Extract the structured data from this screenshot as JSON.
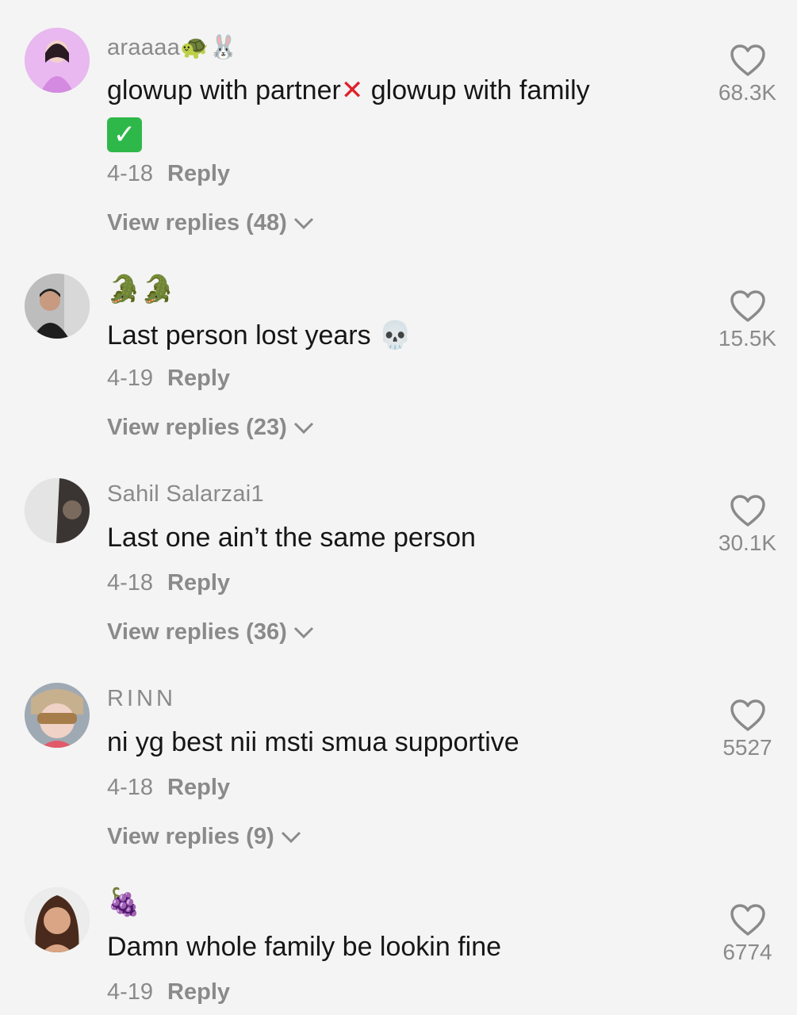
{
  "comments": [
    {
      "author": "araaaa",
      "author_emoji": "🐢🐰",
      "text_part1": "glowup with partner",
      "text_mark1": "✕",
      "text_part2": " glowup with family",
      "text_mark2": "✓",
      "date": "4-18",
      "reply_label": "Reply",
      "view_replies": "View replies (48)",
      "likes": "68.3K"
    },
    {
      "author": "",
      "author_emoji": "🐊🐊",
      "text": "Last person lost years 💀",
      "date": "4-19",
      "reply_label": "Reply",
      "view_replies": "View replies (23)",
      "likes": "15.5K"
    },
    {
      "author": "Sahil Salarzai1",
      "text": "Last one ain’t the same person",
      "date": "4-18",
      "reply_label": "Reply",
      "view_replies": "View replies (36)",
      "likes": "30.1K"
    },
    {
      "author": "RINN",
      "text": "ni yg best nii msti smua supportive",
      "date": "4-18",
      "reply_label": "Reply",
      "view_replies": "View replies (9)",
      "likes": "5527"
    },
    {
      "author": "",
      "author_emoji": "🍇",
      "text": "Damn whole family be lookin fine",
      "date": "4-19",
      "reply_label": "Reply",
      "likes": "6774"
    }
  ],
  "colors": {
    "background": "#f4f4f4",
    "primary_text": "#161616",
    "secondary_text": "#8a8a8a",
    "x_mark": "#e0202a",
    "check_mark_bg": "#2fb84a"
  },
  "icons": {
    "like": "heart-outline-icon",
    "expand": "chevron-down-icon"
  }
}
